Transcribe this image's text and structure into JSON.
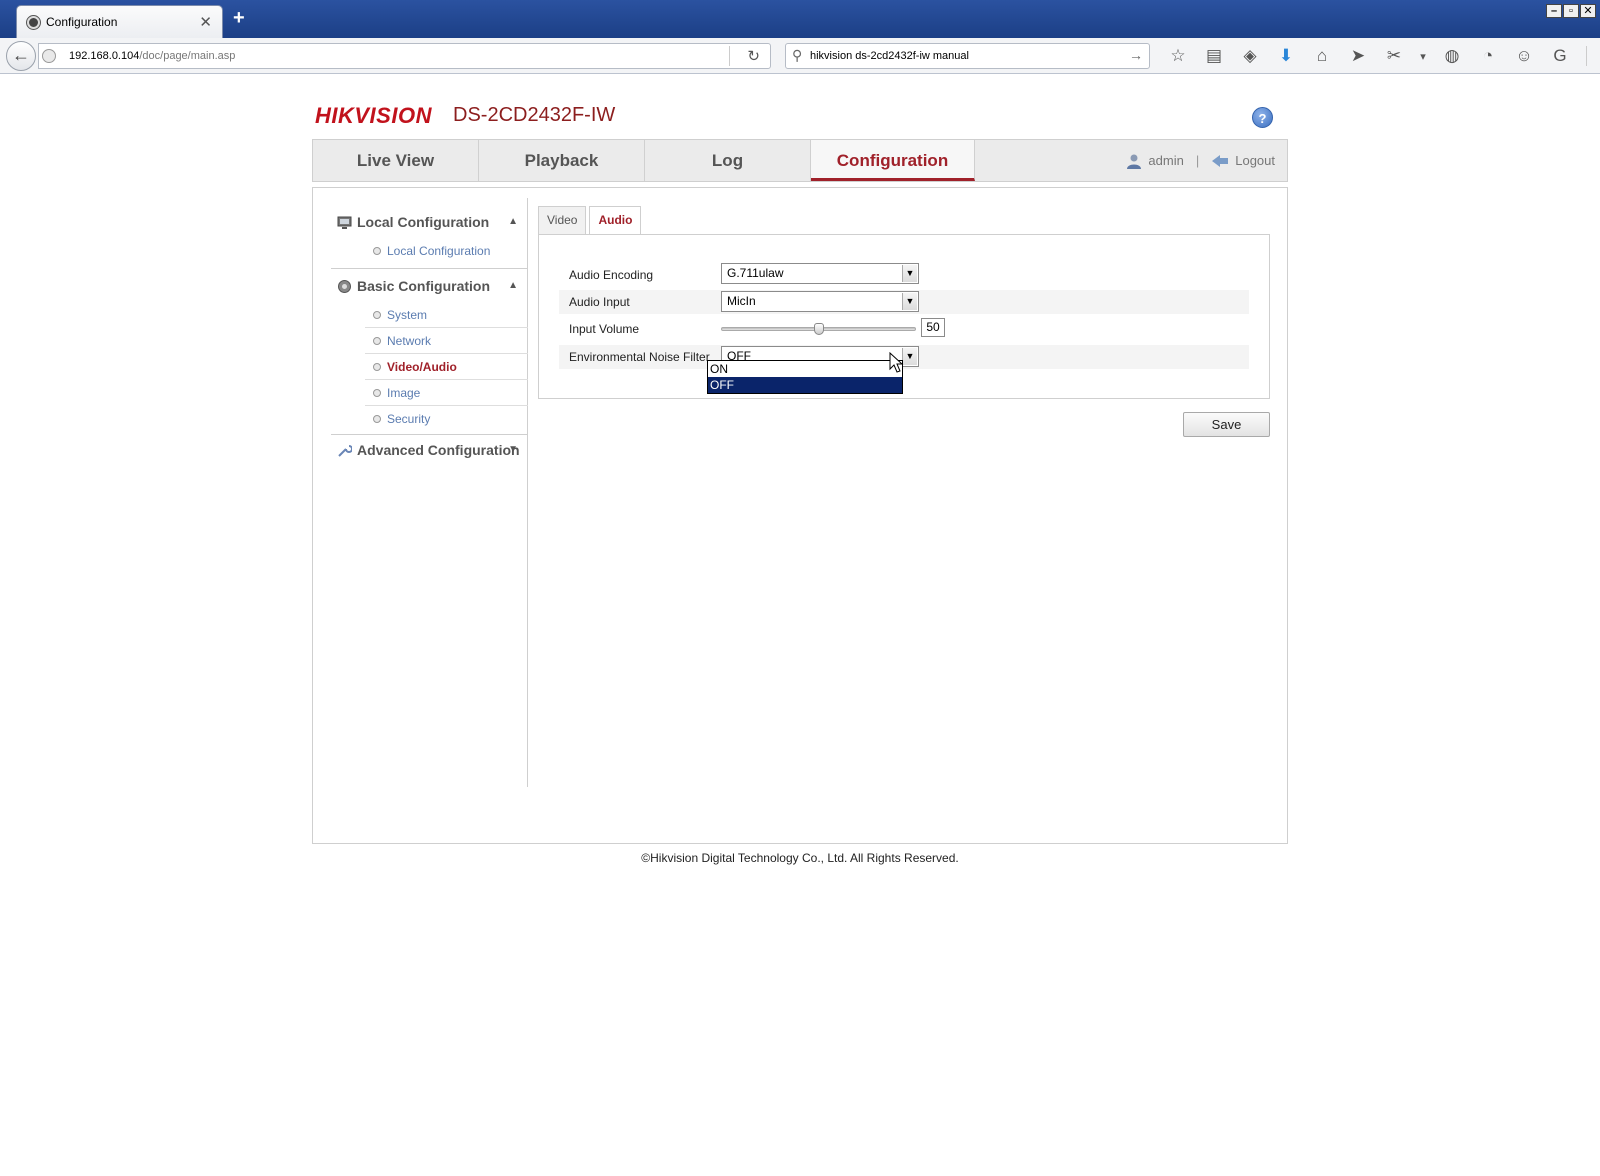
{
  "browser": {
    "tab_title": "Configuration",
    "new_tab": "+",
    "url_host": "192.168.0.104",
    "url_path": "/doc/page/main.asp",
    "search_query": "hikvision ds-2cd2432f-iw manual",
    "window_buttons": [
      "–",
      "▫",
      "✕"
    ]
  },
  "header": {
    "brand": "HIKVISION",
    "model": "DS-2CD2432F-IW",
    "help": "?"
  },
  "topnav": {
    "items": [
      "Live View",
      "Playback",
      "Log",
      "Configuration"
    ],
    "active": "Configuration",
    "user": "admin",
    "separator": "|",
    "logout": "Logout"
  },
  "sidebar": {
    "local_config": "Local Configuration",
    "local_config_item": "Local Configuration",
    "basic_config": "Basic Configuration",
    "basic_items": [
      "System",
      "Network",
      "Video/Audio",
      "Image",
      "Security"
    ],
    "active_item": "Video/Audio",
    "advanced_config": "Advanced Configuration"
  },
  "content": {
    "tabs": [
      "Video",
      "Audio"
    ],
    "active_tab": "Audio",
    "audio_encoding_label": "Audio Encoding",
    "audio_encoding_value": "G.711ulaw",
    "audio_input_label": "Audio Input",
    "audio_input_value": "MicIn",
    "input_volume_label": "Input Volume",
    "input_volume_value": "50",
    "input_volume_fraction": 0.5,
    "noise_filter_label": "Environmental Noise Filter",
    "noise_filter_value": "OFF",
    "noise_filter_options": [
      "ON",
      "OFF"
    ],
    "noise_filter_highlighted": "OFF",
    "save_label": "Save"
  },
  "footer": {
    "copyright": "©Hikvision Digital Technology Co., Ltd. All Rights Reserved."
  },
  "colors": {
    "accent": "#a0212a",
    "link": "#5b7cb0",
    "selection": "#0a246a"
  }
}
